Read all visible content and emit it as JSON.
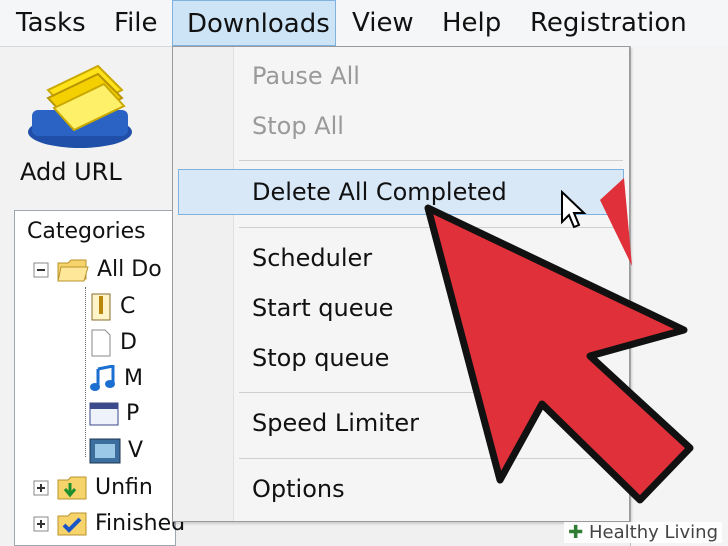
{
  "menubar": {
    "items": [
      "Tasks",
      "File",
      "Downloads",
      "View",
      "Help",
      "Registration"
    ]
  },
  "toolbar": {
    "add_url_label": "Add URL"
  },
  "categories": {
    "title": "Categories",
    "items": [
      {
        "label": "All Do",
        "icon": "folder-open-icon"
      },
      {
        "label": "C",
        "icon": "zip-file-icon"
      },
      {
        "label": "D",
        "icon": "document-icon"
      },
      {
        "label": "M",
        "icon": "music-note-icon"
      },
      {
        "label": "P",
        "icon": "program-window-icon"
      },
      {
        "label": "V",
        "icon": "video-film-icon"
      },
      {
        "label": "Unfin",
        "icon": "folder-download-icon"
      },
      {
        "label": "Finished",
        "icon": "folder-check-icon"
      }
    ]
  },
  "downloads_menu": {
    "items": [
      {
        "label": "Pause All",
        "enabled": false
      },
      {
        "label": "Stop All",
        "enabled": false
      },
      {
        "label": "Delete All Completed",
        "enabled": true,
        "highlighted": true
      },
      {
        "label": "Scheduler",
        "enabled": true
      },
      {
        "label": "Start queue",
        "enabled": true
      },
      {
        "label": "Stop queue",
        "enabled": true
      },
      {
        "label": "Speed Limiter",
        "enabled": true
      },
      {
        "label": "Options",
        "enabled": true
      }
    ]
  },
  "overlay": {
    "arrow_color": "#e0303a"
  },
  "watermark": {
    "text": "Healthy Living"
  }
}
